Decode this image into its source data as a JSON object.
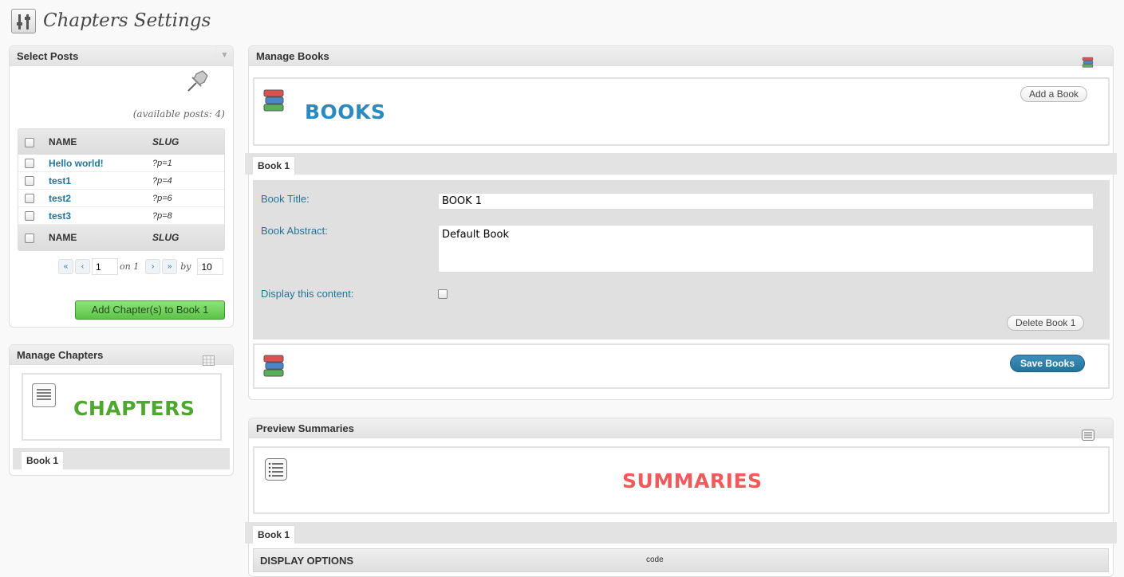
{
  "page": {
    "title": "Chapters Settings"
  },
  "select_posts": {
    "title": "Select Posts",
    "toggle_glyph": "▼",
    "available": "(available posts: 4)",
    "table": {
      "headers": {
        "name": "NAME",
        "slug": "SLUG"
      },
      "rows": [
        {
          "name": "Hello world!",
          "slug": "?p=1"
        },
        {
          "name": "test1",
          "slug": "?p=4"
        },
        {
          "name": "test2",
          "slug": "?p=6"
        },
        {
          "name": "test3",
          "slug": "?p=8"
        }
      ]
    },
    "pagination": {
      "first": "«",
      "prev": "‹",
      "next": "›",
      "last": "»",
      "page_value": "1",
      "on_label": "on 1",
      "by_label": "by",
      "per_page_value": "10"
    },
    "add_button": "Add Chapter(s) to Book 1"
  },
  "manage_chapters": {
    "title": "Manage Chapters",
    "banner": "CHAPTERS",
    "tabs": [
      {
        "label": "Book 1"
      }
    ],
    "banner_color": "#4ea72e"
  },
  "manage_books": {
    "title": "Manage Books",
    "banner": "BOOKS",
    "banner_color": "#2b8ac0",
    "add_book": "Add a Book",
    "tabs": [
      {
        "label": "Book 1"
      }
    ],
    "form": {
      "title_label": "Book Title:",
      "title_value": "BOOK 1",
      "abstract_label": "Book Abstract:",
      "abstract_value": "Default Book",
      "display_label": "Display this content:"
    },
    "delete_button": "Delete Book 1",
    "save_button": "Save Books"
  },
  "preview_summaries": {
    "title": "Preview Summaries",
    "banner": "SUMMARIES",
    "banner_color": "#f05a5a",
    "tabs": [
      {
        "label": "Book 1"
      }
    ],
    "display_options_heading": "DISPLAY OPTIONS",
    "code_label": "code"
  },
  "icons": [
    "settings-icon",
    "pushpin-icon",
    "books-icon",
    "list-icon",
    "document-icon",
    "grid-icon",
    "checkbox-icon"
  ],
  "colors": {
    "link": "#21759b",
    "primary_button": "#21759b",
    "success_button": "#5cc348"
  }
}
